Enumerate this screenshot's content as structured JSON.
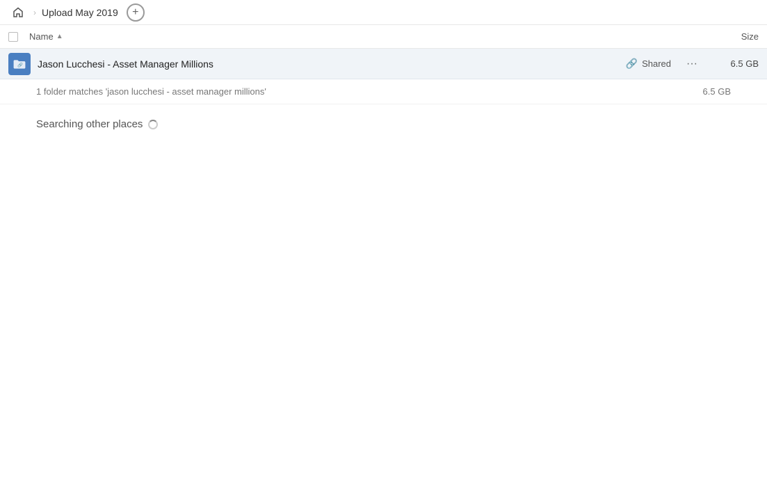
{
  "topbar": {
    "home_label": "Home",
    "breadcrumb_label": "Upload May 2019",
    "add_button_label": "+"
  },
  "columns": {
    "name_label": "Name",
    "sort_indicator": "▲",
    "size_label": "Size"
  },
  "file_row": {
    "name": "Jason Lucchesi - Asset Manager Millions",
    "shared_label": "Shared",
    "more_label": "···",
    "size": "6.5 GB"
  },
  "result_info": {
    "text": "1 folder matches 'jason lucchesi - asset manager millions'",
    "size": "6.5 GB"
  },
  "searching": {
    "text": "Searching other places"
  }
}
